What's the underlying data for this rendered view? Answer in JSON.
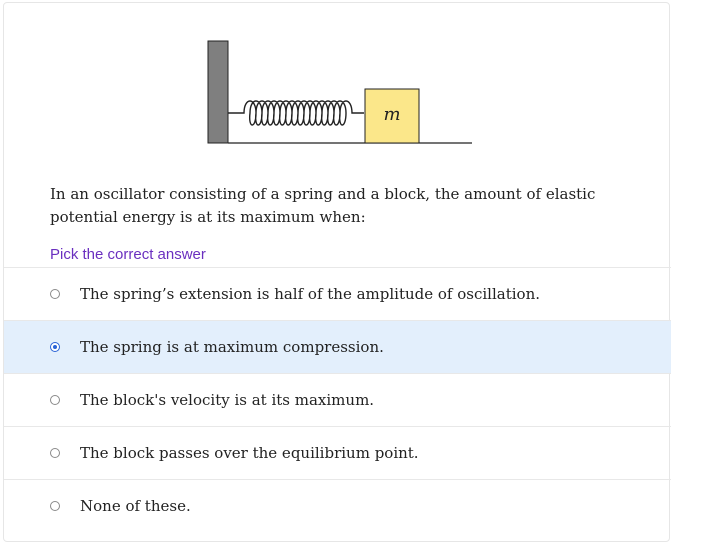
{
  "figure": {
    "block_label": "m",
    "wall_color": "#7f7f7f",
    "block_color": "#fbe78a"
  },
  "question": {
    "text": "In an oscillator consisting of a spring and a block, the amount of elastic potential energy is at its maximum when:",
    "instruction": "Pick the correct answer"
  },
  "options": [
    {
      "label": "The spring’s extension is half of the amplitude of oscillation.",
      "selected": false
    },
    {
      "label": "The spring is at maximum compression.",
      "selected": true
    },
    {
      "label": "The block's velocity is at its maximum.",
      "selected": false
    },
    {
      "label": "The block passes over the equilibrium point.",
      "selected": false
    },
    {
      "label": "None of these.",
      "selected": false
    }
  ],
  "colors": {
    "selected_bg": "#e3effc",
    "accent": "#2a63d6",
    "instruction": "#6a2fbf"
  }
}
